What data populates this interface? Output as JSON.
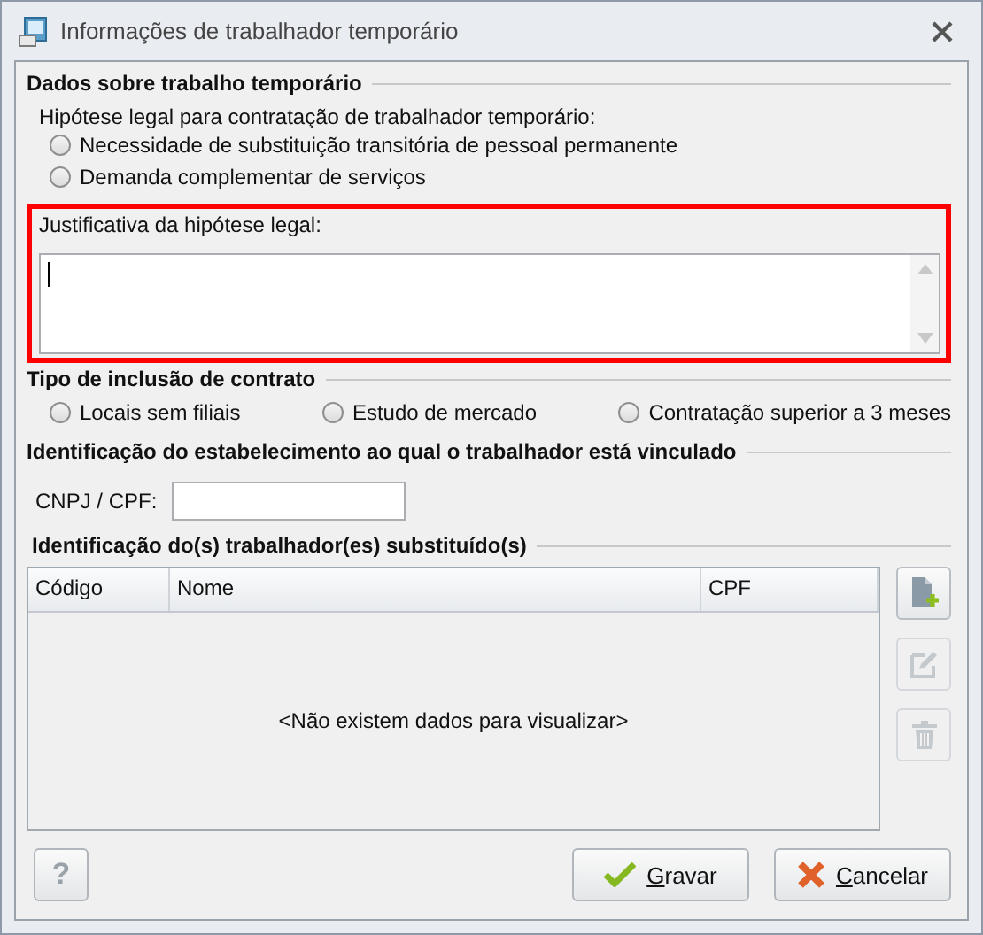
{
  "window": {
    "title": "Informações de trabalhador temporário"
  },
  "section_temp": {
    "title": "Dados sobre trabalho temporário",
    "question": "Hipótese legal para contratação de trabalhador temporário:",
    "options": [
      {
        "label": "Necessidade de substituição transitória de pessoal permanente",
        "selected": false
      },
      {
        "label": "Demanda complementar de serviços",
        "selected": false
      }
    ],
    "justification": {
      "label": "Justificativa da hipótese legal:",
      "highlighted": true,
      "focused": true
    }
  },
  "section_inclusion": {
    "title": "Tipo de inclusão de contrato",
    "options": [
      {
        "label": "Locais sem filiais",
        "selected": false
      },
      {
        "label": "Estudo de mercado",
        "selected": false
      },
      {
        "label": "Contratação superior a 3 meses",
        "selected": false
      }
    ]
  },
  "section_establishment": {
    "title": "Identificação do estabelecimento ao qual o trabalhador está vinculado",
    "field_label": "CNPJ / CPF:"
  },
  "section_replaced": {
    "title": "Identificação do(s) trabalhador(es) substituído(s)",
    "table": {
      "columns": [
        "Código",
        "Nome",
        "CPF"
      ],
      "empty_message": "<Não existem dados para visualizar>"
    },
    "tools": [
      {
        "kind": "add",
        "disabled": false
      },
      {
        "kind": "edit",
        "disabled": true
      },
      {
        "kind": "delete",
        "disabled": true
      }
    ]
  },
  "buttons": [
    {
      "kind": "help",
      "label": "?"
    },
    {
      "kind": "save",
      "mnemonic": "G",
      "label_rest": "ravar"
    },
    {
      "kind": "cancel",
      "mnemonic": "C",
      "label_rest": "ancelar"
    }
  ]
}
